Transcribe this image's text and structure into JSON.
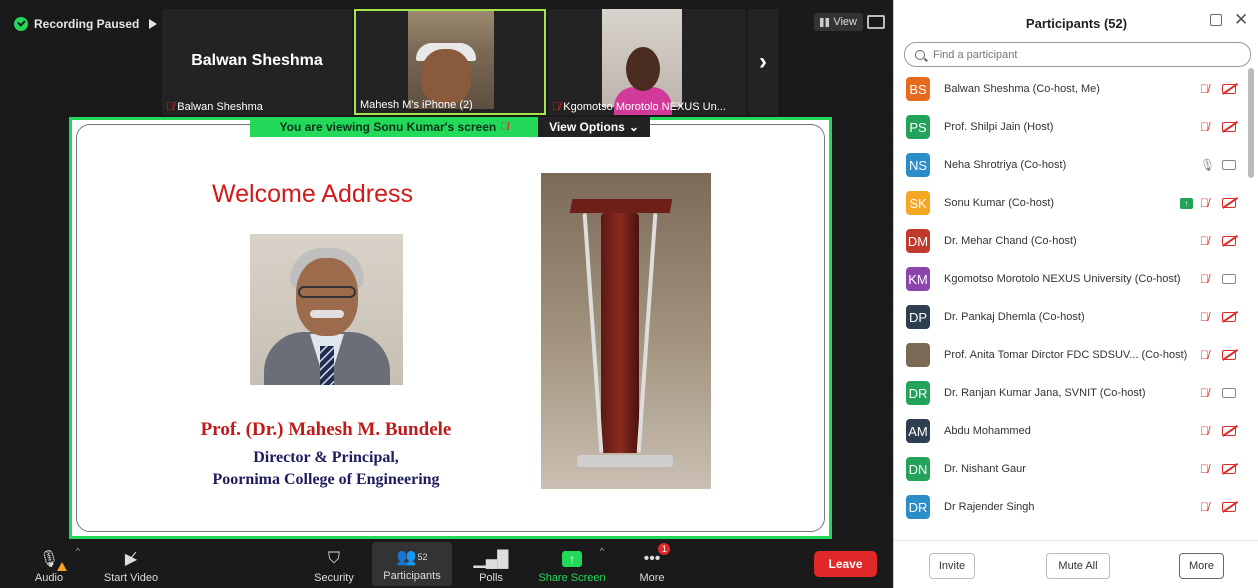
{
  "recording": {
    "label": "Recording Paused"
  },
  "top": {
    "view_label": "View"
  },
  "tiles": [
    {
      "name": "Balwan Sheshma",
      "big_name": "Balwan Sheshma"
    },
    {
      "name": "Mahesh M's iPhone (2)"
    },
    {
      "name": "Kgomotso Morotolo NEXUS Un..."
    }
  ],
  "share_banner": {
    "text": "You are viewing  Sonu Kumar's screen",
    "options_label": "View Options"
  },
  "slide": {
    "title": "Welcome Address",
    "name": "Prof. (Dr.) Mahesh M. Bundele",
    "role": "Director & Principal,",
    "college": "Poornima College of Engineering"
  },
  "toolbar": {
    "audio": "Audio",
    "video": "Start Video",
    "security": "Security",
    "participants": "Participants",
    "participants_count": "52",
    "polls": "Polls",
    "share": "Share Screen",
    "more": "More",
    "more_badge": "1",
    "leave": "Leave"
  },
  "panel": {
    "title": "Participants (52)",
    "search_placeholder": "Find a participant",
    "participants": [
      {
        "initials": "BS",
        "color": "#e66b1f",
        "name": "Balwan Sheshma (Co-host, Me)",
        "mic": "muted",
        "cam": "off"
      },
      {
        "initials": "PS",
        "color": "#23a35a",
        "name": "Prof. Shilpi Jain (Host)",
        "mic": "muted",
        "cam": "off"
      },
      {
        "initials": "NS",
        "color": "#2c8ec9",
        "name": "Neha Shrotriya (Co-host)",
        "mic": "on",
        "cam": "on"
      },
      {
        "initials": "SK",
        "color": "#f5a623",
        "name": "Sonu Kumar (Co-host)",
        "mic": "muted",
        "cam": "off",
        "sharing": true
      },
      {
        "initials": "DM",
        "color": "#c0392b",
        "name": "Dr. Mehar Chand (Co-host)",
        "mic": "muted",
        "cam": "off"
      },
      {
        "initials": "KM",
        "color": "#8e44ad",
        "name": "Kgomotso Morotolo NEXUS University (Co-host)",
        "mic": "muted",
        "cam": "on"
      },
      {
        "initials": "DP",
        "color": "#2c3e50",
        "name": "Dr. Pankaj Dhemla (Co-host)",
        "mic": "muted",
        "cam": "off"
      },
      {
        "initials": "",
        "color": "#7a6a55",
        "name": "Prof. Anita Tomar Dirctor FDC SDSUV...  (Co-host)",
        "mic": "muted",
        "cam": "off"
      },
      {
        "initials": "DR",
        "color": "#23a35a",
        "name": "Dr. Ranjan Kumar Jana, SVNIT (Co-host)",
        "mic": "muted",
        "cam": "on"
      },
      {
        "initials": "AM",
        "color": "#2c3e50",
        "name": "Abdu Mohammed",
        "mic": "muted",
        "cam": "off"
      },
      {
        "initials": "DN",
        "color": "#23a35a",
        "name": "Dr. Nishant Gaur",
        "mic": "muted",
        "cam": "off"
      },
      {
        "initials": "DR",
        "color": "#2c8ec9",
        "name": "Dr Rajender Singh",
        "mic": "muted",
        "cam": "off"
      }
    ],
    "invite": "Invite",
    "mute_all": "Mute All",
    "more": "More"
  }
}
